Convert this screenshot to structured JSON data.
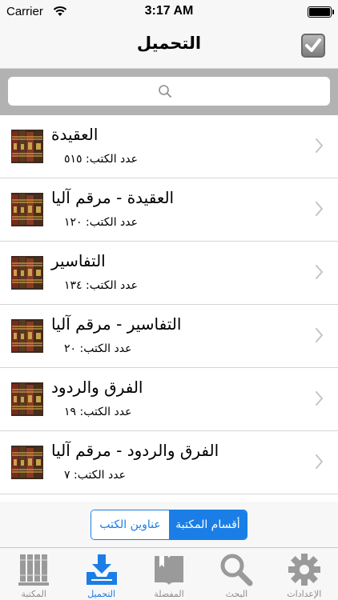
{
  "status_bar": {
    "carrier": "Carrier",
    "time": "3:17 AM"
  },
  "nav": {
    "title": "التحميل",
    "check_icon": "checkbox-checked-icon"
  },
  "search": {
    "icon": "search-icon",
    "placeholder": ""
  },
  "rows": [
    {
      "title": "العقيدة",
      "count": "عدد الكتب: ٥١٥"
    },
    {
      "title": "العقيدة - مرقم آليا",
      "count": "عدد الكتب: ١٢٠"
    },
    {
      "title": "التفاسير",
      "count": "عدد الكتب: ١٣٤"
    },
    {
      "title": "التفاسير - مرقم آليا",
      "count": "عدد الكتب: ٢٠"
    },
    {
      "title": "الفرق والردود",
      "count": "عدد الكتب: ١٩"
    },
    {
      "title": "الفرق والردود - مرقم آليا",
      "count": "عدد الكتب: ٧"
    }
  ],
  "segment": {
    "left": "عناوين الكتب",
    "right": "أقسام المكتبة",
    "selected": "أقسام المكتبة"
  },
  "tabs": [
    {
      "label": "المكتبة",
      "icon": "books-icon"
    },
    {
      "label": "التحميل",
      "icon": "download-tray-icon"
    },
    {
      "label": "المفضلة",
      "icon": "bookmark-book-icon"
    },
    {
      "label": "البحث",
      "icon": "magnifier-icon"
    },
    {
      "label": "الإعدادات",
      "icon": "gear-icon"
    }
  ],
  "colors": {
    "accent": "#1a7ee6",
    "search_bar_bg": "#b2b2b2",
    "bar_bg": "#f7f7f7"
  }
}
